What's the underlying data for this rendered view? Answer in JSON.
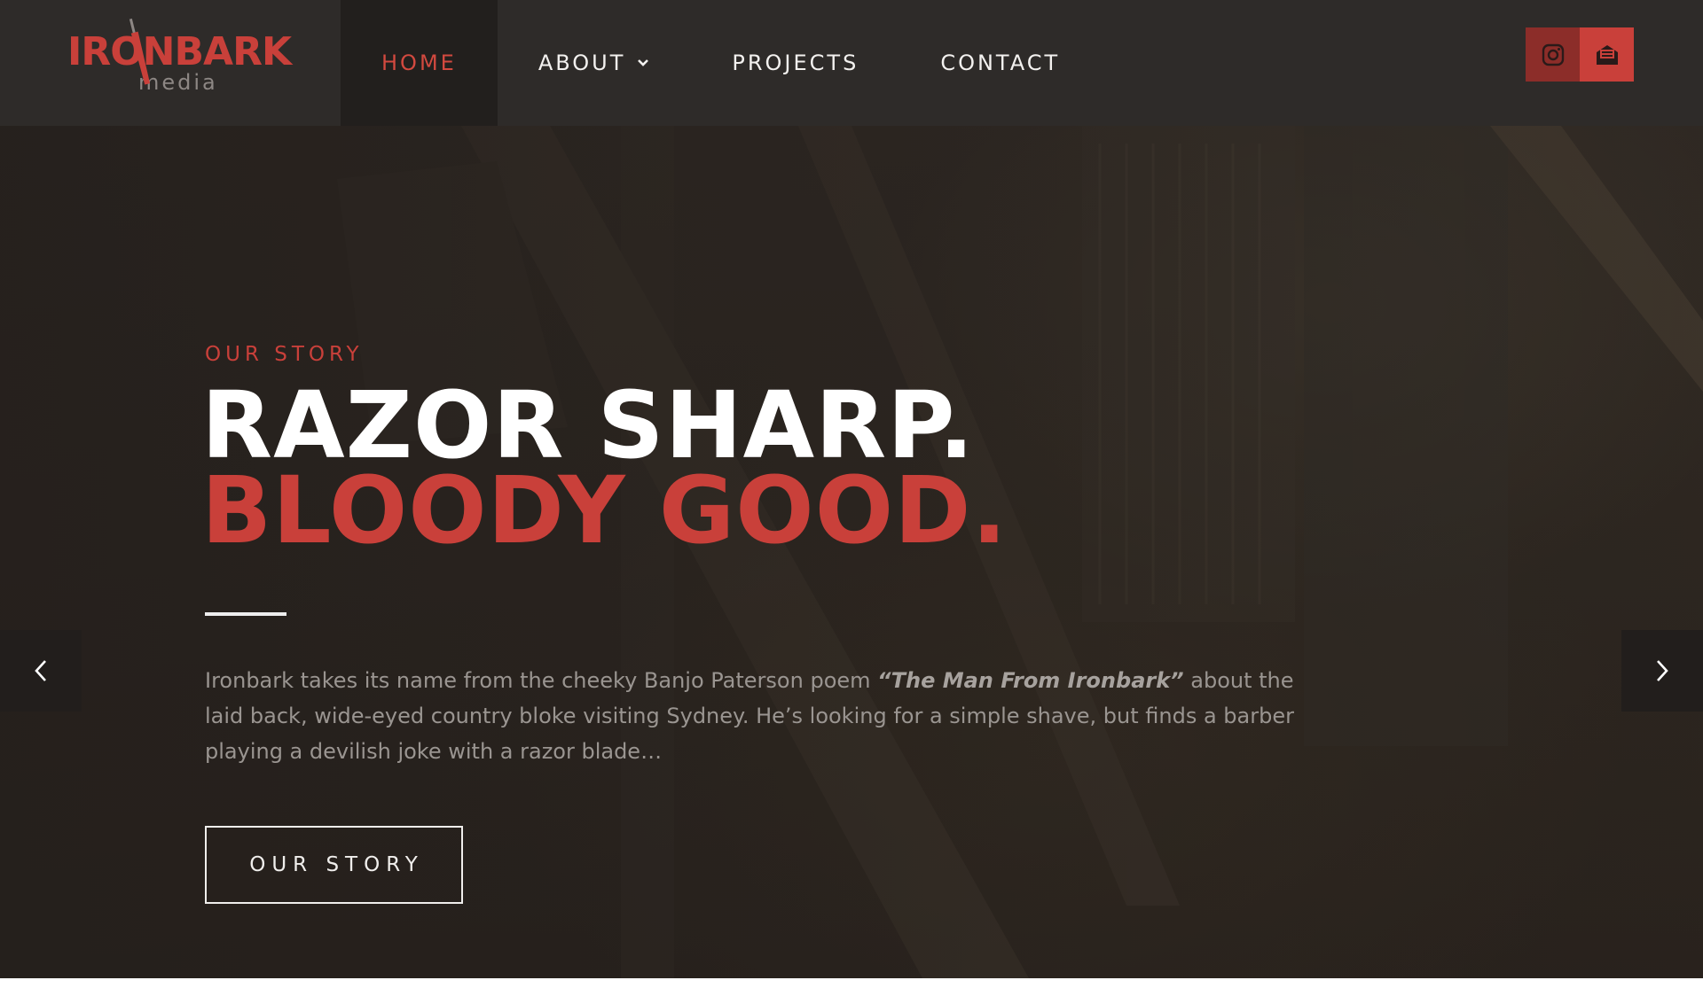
{
  "brand": {
    "name": "IRONBARK",
    "sub": "media",
    "accent": "#c9403a"
  },
  "nav": {
    "items": [
      {
        "label": "HOME",
        "active": true
      },
      {
        "label": "ABOUT",
        "has_dropdown": true
      },
      {
        "label": "PROJECTS"
      },
      {
        "label": "CONTACT"
      }
    ]
  },
  "social": {
    "instagram_icon": "instagram-icon",
    "email_icon": "email-icon"
  },
  "hero": {
    "eyebrow": "OUR STORY",
    "headline_line1": "RAZOR SHARP.",
    "headline_line2": "BLOODY GOOD.",
    "blurb_before": "Ironbark takes its name from the cheeky Banjo Paterson poem ",
    "blurb_title": "“The Man From Ironbark”",
    "blurb_after": " about the laid back, wide-eyed country bloke visiting Sydney. He’s looking for a simple shave, but finds a barber playing a devilish joke with a razor blade…",
    "cta_label": "OUR STORY"
  },
  "slider": {
    "prev_icon": "chevron-left-icon",
    "next_icon": "chevron-right-icon"
  }
}
